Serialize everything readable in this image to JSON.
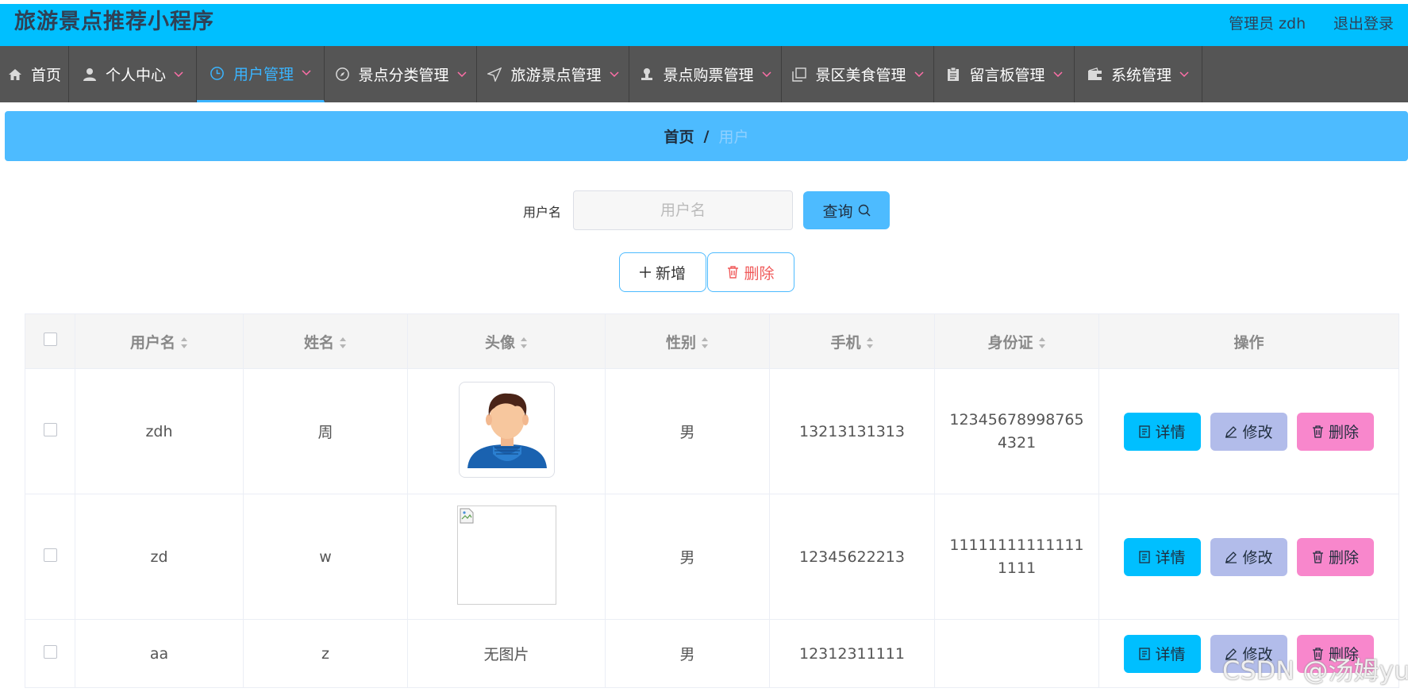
{
  "header": {
    "title": "旅游景点推荐小程序",
    "admin": "管理员 zdh",
    "logout": "退出登录"
  },
  "nav": [
    {
      "label": "首页",
      "icon": "home-icon",
      "dropdown": false
    },
    {
      "label": "个人中心",
      "icon": "user-icon",
      "dropdown": true
    },
    {
      "label": "用户管理",
      "icon": "clock-icon",
      "dropdown": true,
      "active": true
    },
    {
      "label": "景点分类管理",
      "icon": "compass-icon",
      "dropdown": true
    },
    {
      "label": "旅游景点管理",
      "icon": "location-arrow-icon",
      "dropdown": true
    },
    {
      "label": "景点购票管理",
      "icon": "stamp-icon",
      "dropdown": true
    },
    {
      "label": "景区美食管理",
      "icon": "copy-icon",
      "dropdown": true
    },
    {
      "label": "留言板管理",
      "icon": "clipboard-icon",
      "dropdown": true
    },
    {
      "label": "系统管理",
      "icon": "wallet-icon",
      "dropdown": true
    }
  ],
  "breadcrumb": {
    "home": "首页",
    "separator": "/",
    "current": "用户"
  },
  "search": {
    "label": "用户名",
    "placeholder": "用户名",
    "value": "",
    "query_button": "查询"
  },
  "actions": {
    "add": "新增",
    "delete": "删除"
  },
  "table": {
    "columns": [
      "用户名",
      "姓名",
      "头像",
      "性别",
      "手机",
      "身份证",
      "操作"
    ],
    "rows": [
      {
        "username": "zdh",
        "name": "周",
        "avatar": "avatar-image",
        "gender": "男",
        "phone": "13213131313",
        "id_card": "123456789987654321"
      },
      {
        "username": "zd",
        "name": "w",
        "avatar": "broken-image",
        "gender": "男",
        "phone": "12345622213",
        "id_card": "111111111111111111"
      },
      {
        "username": "aa",
        "name": "z",
        "avatar": "无图片",
        "gender": "男",
        "phone": "12312311111",
        "id_card": ""
      }
    ],
    "row_actions": {
      "detail": "详情",
      "edit": "修改",
      "delete": "删除"
    }
  },
  "watermark": "CSDN @汤姆yu",
  "colors": {
    "header_bg": "#00bfff",
    "nav_bg": "#555555",
    "nav_active": "#3ab4ff",
    "crumb_bg": "#4dbbff",
    "detail_btn": "#00bfff",
    "edit_btn": "#b2bcea",
    "delete_btn": "#f887cc",
    "delete_text": "#f05a5a"
  }
}
